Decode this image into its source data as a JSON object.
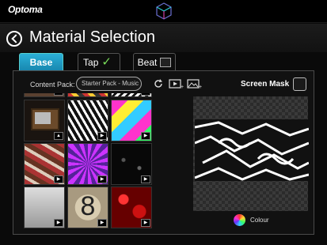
{
  "app": {
    "brand": "Optoma"
  },
  "header": {
    "title": "Material Selection"
  },
  "tabs": [
    {
      "label": "Base",
      "active": true
    },
    {
      "label": "Tap",
      "checked": true
    },
    {
      "label": "Beat",
      "checked": false
    }
  ],
  "content_pack": {
    "label": "Content Pack:",
    "selected": "Starter Pack - Music"
  },
  "screen_mask": {
    "label": "Screen Mask",
    "checked": false
  },
  "thumbnails": [
    {
      "name": "tv"
    },
    {
      "name": "black-white-swirl"
    },
    {
      "name": "neon-shapes"
    },
    {
      "name": "red-brown-collage"
    },
    {
      "name": "purple-rays"
    },
    {
      "name": "black-particles"
    },
    {
      "name": "grey-static"
    },
    {
      "name": "countdown-8",
      "text": "8"
    },
    {
      "name": "red-hearts"
    }
  ],
  "colour": {
    "label": "Colour"
  },
  "colors": {
    "accent": "#1e9fd0",
    "check": "#7adf5a"
  }
}
